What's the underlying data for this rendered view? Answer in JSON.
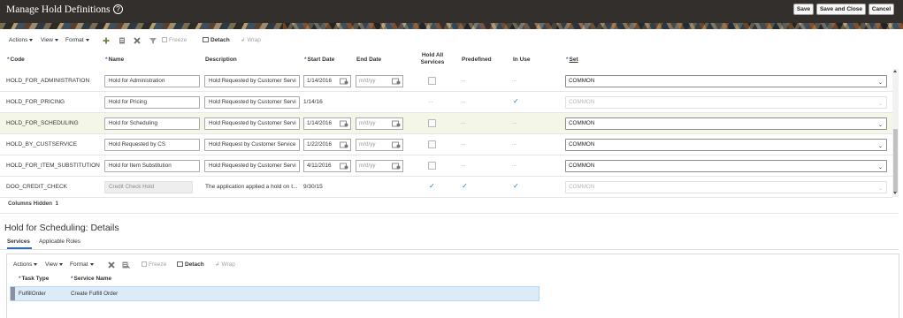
{
  "header": {
    "title": "Manage Hold Definitions",
    "help_icon": "?",
    "buttons": {
      "save": "Save",
      "save_and_close": "Save and Close",
      "cancel": "Cancel"
    }
  },
  "toolbar": {
    "actions": "Actions",
    "view": "View",
    "format": "Format",
    "freeze": "Freeze",
    "detach": "Detach",
    "wrap": "Wrap"
  },
  "table": {
    "columns": {
      "code": "Code",
      "name": "Name",
      "description": "Description",
      "start_date": "Start Date",
      "end_date": "End Date",
      "hold_all_services_line1": "Hold All",
      "hold_all_services_line2": "Services",
      "predefined": "Predefined",
      "in_use": "In Use",
      "set": "Set"
    },
    "date_placeholder": "m/d/yy",
    "rows": [
      {
        "code": "HOLD_FOR_ADMINISTRATION",
        "name": "Hold for Administration",
        "description": "Hold Requested by Customer Servi",
        "start_date": "1/14/2016",
        "end_date": "m/d/yy",
        "hold_all": "unchecked",
        "predefined": "...",
        "in_use": "...",
        "set": "COMMON"
      },
      {
        "code": "HOLD_FOR_PRICING",
        "name": "Hold for Pricing",
        "description": "Hold Requested by Customer Servi",
        "start_date": "1/14/16",
        "end_date": "",
        "hold_all": "...",
        "predefined": "...",
        "in_use": "✓",
        "set": "COMMON"
      },
      {
        "code": "HOLD_FOR_SCHEDULING",
        "name": "Hold for Scheduling",
        "description": "Hold Requested by Customer Servi",
        "start_date": "1/14/2016",
        "end_date": "m/d/yy",
        "hold_all": "unchecked",
        "predefined": "...",
        "in_use": "...",
        "set": "COMMON"
      },
      {
        "code": "HOLD_BY_CUSTSERVICE",
        "name": "Hold Requested by CS",
        "description": "Hold Request by Customer Service",
        "start_date": "1/22/2016",
        "end_date": "m/d/yy",
        "hold_all": "unchecked",
        "predefined": "...",
        "in_use": "...",
        "set": "COMMON"
      },
      {
        "code": "HOLD_FOR_ITEM_SUBSTITUTION",
        "name": "Hold for Item Substitution",
        "description": "Hold Requested by Customer Servi",
        "start_date": "4/11/2016",
        "end_date": "m/d/yy",
        "hold_all": "unchecked",
        "predefined": "...",
        "in_use": "...",
        "set": "COMMON"
      },
      {
        "code": "DOO_CREDIT_CHECK",
        "name": "Credit Check Hold",
        "description": "The application applied a hold on t...",
        "start_date": "9/30/15",
        "end_date": "",
        "hold_all": "✓",
        "predefined": "✓",
        "in_use": "✓",
        "set": "COMMON"
      }
    ],
    "columns_hidden_label": "Columns Hidden",
    "columns_hidden_count": "1"
  },
  "details": {
    "title": "Hold for Scheduling: Details",
    "tabs": [
      "Services",
      "Applicable Roles"
    ],
    "toolbar": {
      "actions": "Actions",
      "view": "View",
      "format": "Format",
      "freeze": "Freeze",
      "detach": "Detach",
      "wrap": "Wrap"
    },
    "columns": {
      "task_type": "Task Type",
      "service_name": "Service Name"
    },
    "rows": [
      {
        "task_type": "FulfillOrder",
        "service_name": "Create Fulfill Order"
      }
    ]
  },
  "colors": {
    "header_bg": "#322f2d",
    "selected_row": "#f4f7e7",
    "detail_row": "#dbebf7",
    "accent": "#2d6eb5",
    "check": "#3a6ea5"
  }
}
